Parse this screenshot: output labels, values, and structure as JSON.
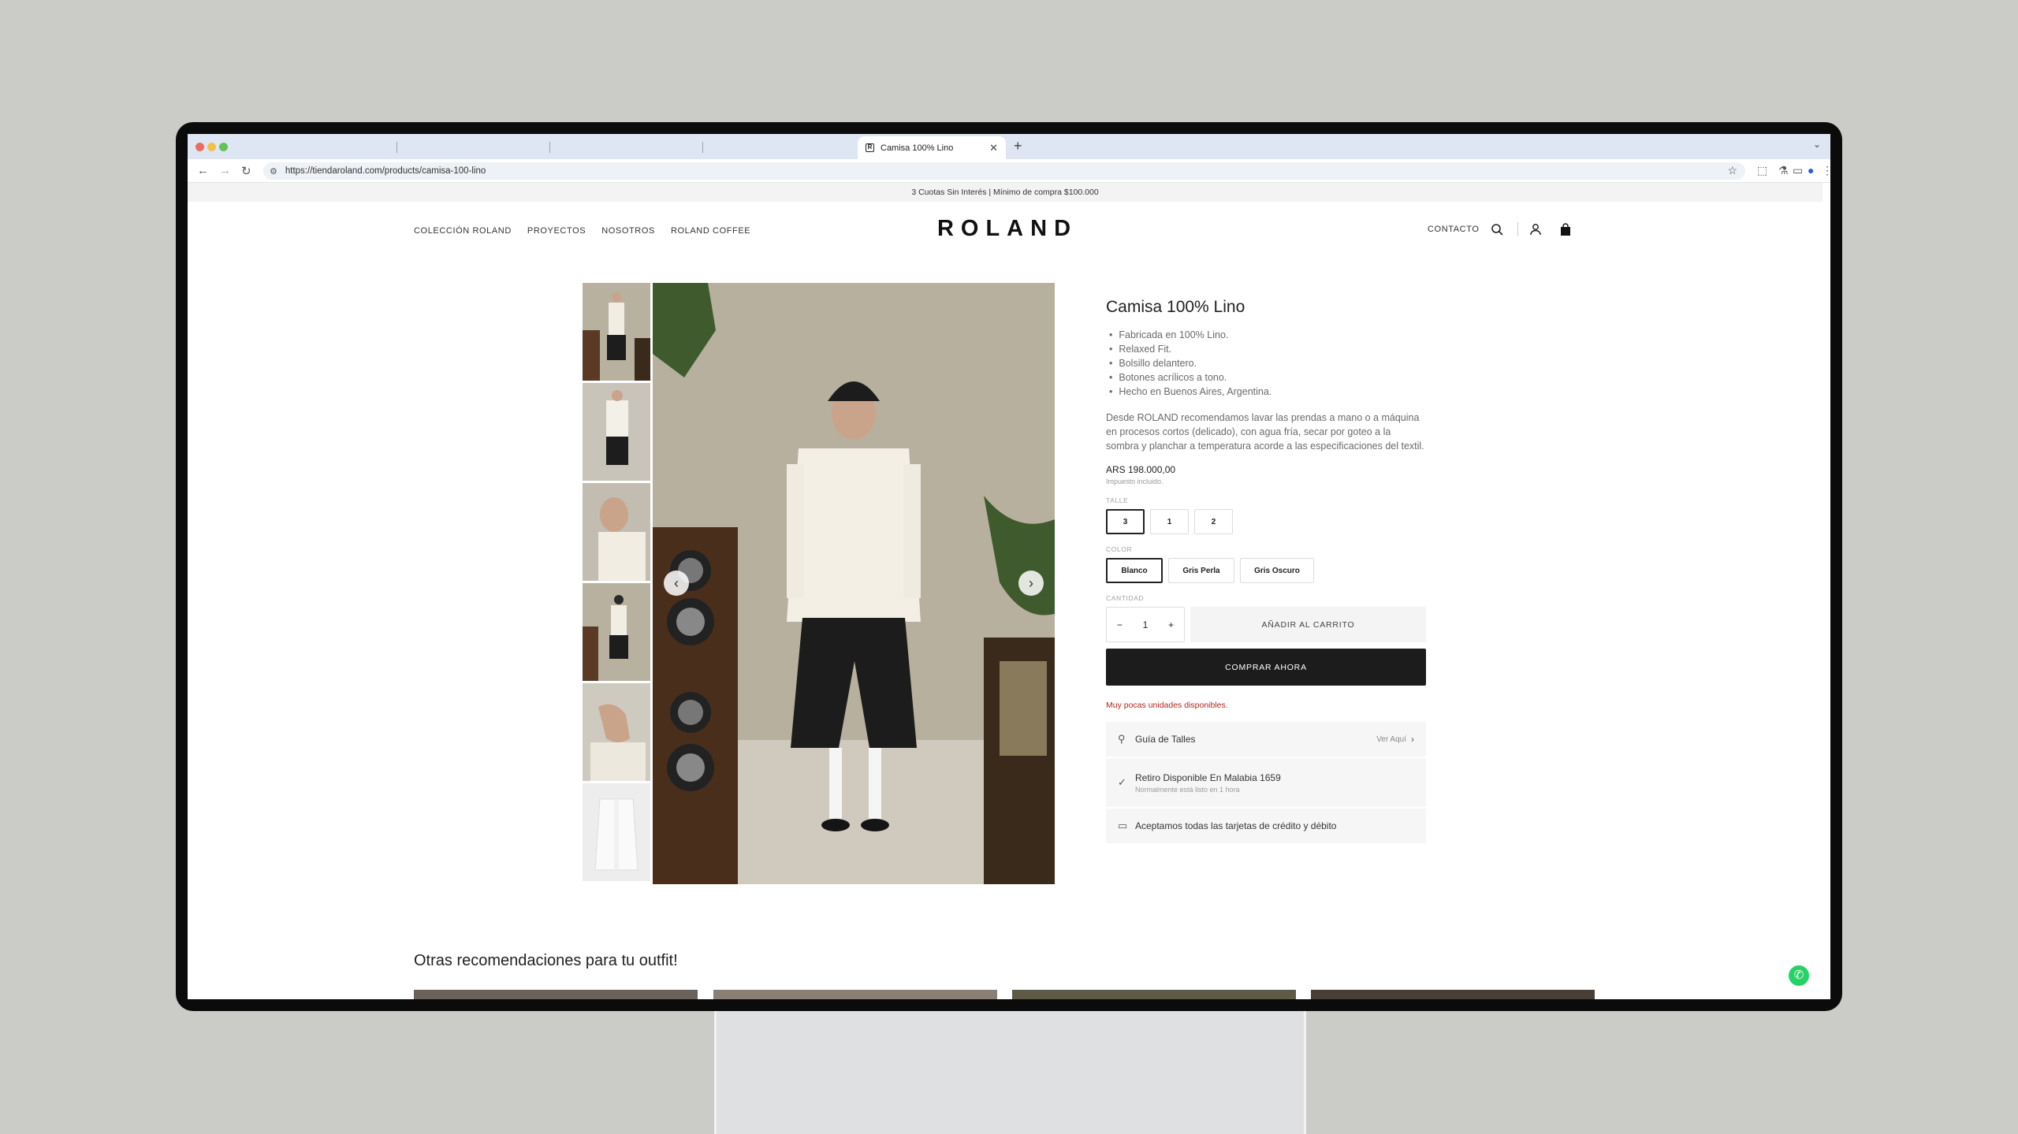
{
  "browser": {
    "tab_title": "Camisa 100% Lino",
    "tab_favicon": "R",
    "url": "https://tiendaroland.com/products/camisa-100-lino",
    "icons": [
      "back-icon",
      "forward-icon",
      "reload-icon",
      "site-settings-icon",
      "bookmark-star-icon",
      "extensions-icon",
      "labs-icon",
      "cast-icon",
      "profile-icon",
      "menu-icon"
    ]
  },
  "announcement": "3 Cuotas Sin Interés | Mínimo de compra $100.000",
  "header": {
    "nav": [
      "COLECCIÓN ROLAND",
      "PROYECTOS",
      "NOSOTROS",
      "ROLAND COFFEE"
    ],
    "logo": "ROLAND",
    "contact": "CONTACTO"
  },
  "product": {
    "title": "Camisa 100% Lino",
    "bullets": [
      "Fabricada en 100% Lino.",
      "Relaxed Fit.",
      "Bolsillo delantero.",
      "Botones acrílicos a tono.",
      "Hecho en Buenos Aires, Argentina."
    ],
    "description": "Desde ROLAND recomendamos lavar las prendas a mano o a máquina en procesos cortos (delicado), con agua fría, secar por goteo a la sombra y planchar a temperatura acorde a las especificaciones del textil.",
    "price": "ARS 198.000,00",
    "tax_note": "Impuesto incluido.",
    "size_label": "TALLE",
    "sizes": [
      "3",
      "1",
      "2"
    ],
    "selected_size": "3",
    "color_label": "COLOR",
    "colors": [
      "Blanco",
      "Gris Perla",
      "Gris Oscuro"
    ],
    "selected_color": "Blanco",
    "qty_label": "CANTIDAD",
    "qty": "1",
    "add_to_cart": "AÑADIR AL CARRITO",
    "buy_now": "COMPRAR AHORA",
    "low_stock": "Muy pocas unidades disponibles.",
    "size_guide": "Guía de Talles",
    "size_guide_link": "Ver Aquí",
    "pickup": "Retiro Disponible En Malabia 1659",
    "pickup_sub": "Normalmente está listo en 1 hora",
    "payment": "Aceptamos todas las tarjetas de crédito y débito"
  },
  "recommendations_title": "Otras recomendaciones para tu outfit!",
  "colors": {
    "accent_dark": "#1c1c1c",
    "low_stock_red": "#b0261c",
    "whatsapp": "#25d366"
  }
}
